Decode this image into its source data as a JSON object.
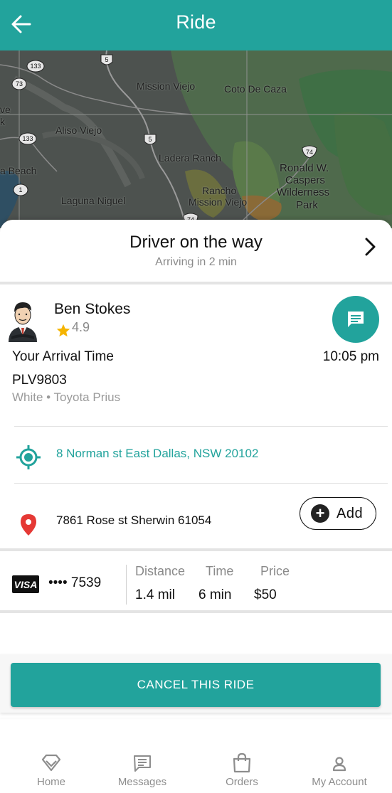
{
  "header": {
    "title": "Ride"
  },
  "map": {
    "labels": [
      "Mission Viejo",
      "Coto De Caza",
      "Aliso Viejo",
      "Ladera Ranch",
      "Ronald W.",
      "Caspers",
      "Wilderness",
      "Park",
      "Laguna Niguel",
      "Rancho",
      "Mission Viejo",
      "a Beach",
      "ve",
      "k"
    ],
    "route_shields": [
      "133",
      "73",
      "133",
      "1",
      "5",
      "5",
      "74",
      "74"
    ]
  },
  "status": {
    "title": "Driver on the way",
    "subtitle": "Arriving in 2 min"
  },
  "driver": {
    "name": "Ben Stokes",
    "rating": "4.9",
    "arrival_label": "Your Arrival Time",
    "arrival_time": "10:05 pm",
    "plate": "PLV9803",
    "car": "White • Toyota Prius"
  },
  "trip": {
    "pickup": "8 Norman st East Dallas, NSW 20102",
    "dropoff": "7861 Rose st Sherwin 61054",
    "add_label": "Add"
  },
  "payment": {
    "card_brand": "VISA",
    "card_masked": "•••• 7539",
    "stats": [
      {
        "label": "Distance",
        "value": "1.4 mil"
      },
      {
        "label": "Time",
        "value": "6 min"
      },
      {
        "label": "Price",
        "value": "$50"
      }
    ]
  },
  "cancel_label": "CANCEL THIS RIDE",
  "tabs": [
    {
      "label": "Home",
      "icon": "home-icon"
    },
    {
      "label": "Messages",
      "icon": "messages-icon"
    },
    {
      "label": "Orders",
      "icon": "orders-icon"
    },
    {
      "label": "My Account",
      "icon": "account-icon"
    }
  ],
  "colors": {
    "accent": "#22a39c",
    "pin": "#e53935",
    "star": "#f5b400"
  }
}
